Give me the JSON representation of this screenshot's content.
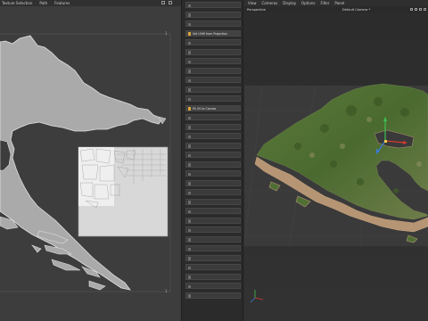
{
  "uv_editor": {
    "menu": [
      "Texture Selection",
      "Path",
      "Features"
    ],
    "tick_top_right": "1",
    "tick_bottom_right": "1"
  },
  "commands": [
    {
      "label": "",
      "state": "dim",
      "icon": "command-icon"
    },
    {
      "label": "",
      "state": "dim",
      "icon": "command-icon"
    },
    {
      "label": "",
      "state": "dim",
      "icon": "command-icon"
    },
    {
      "label": "Set UVW from Projection",
      "state": "bright",
      "icon": "projection-icon"
    },
    {
      "label": "",
      "state": "dim",
      "icon": "command-icon"
    },
    {
      "label": "",
      "state": "dim",
      "icon": "command-icon"
    },
    {
      "label": "",
      "state": "dim",
      "icon": "command-icon"
    },
    {
      "label": "",
      "state": "dim",
      "icon": "command-icon"
    },
    {
      "label": "",
      "state": "dim",
      "icon": "command-icon"
    },
    {
      "label": "",
      "state": "dim",
      "icon": "command-icon"
    },
    {
      "label": "",
      "state": "dim",
      "icon": "command-icon"
    },
    {
      "label": "Fit UV to Canvas",
      "state": "bright",
      "icon": "fit-canvas-icon"
    },
    {
      "label": "",
      "state": "dim",
      "icon": "command-icon"
    },
    {
      "label": "",
      "state": "dim",
      "icon": "command-icon"
    },
    {
      "label": "",
      "state": "dim",
      "icon": "command-icon"
    },
    {
      "label": "",
      "state": "dim",
      "icon": "command-icon"
    },
    {
      "label": "",
      "state": "dim",
      "icon": "command-icon"
    },
    {
      "label": "",
      "state": "dim",
      "icon": "command-icon"
    },
    {
      "label": "",
      "state": "dim",
      "icon": "command-icon"
    },
    {
      "label": "",
      "state": "dim",
      "icon": "command-icon"
    },
    {
      "label": "",
      "state": "dim",
      "icon": "command-icon"
    },
    {
      "label": "",
      "state": "dim",
      "icon": "command-icon"
    },
    {
      "label": "",
      "state": "dim",
      "icon": "command-icon"
    },
    {
      "label": "",
      "state": "dim",
      "icon": "command-icon"
    },
    {
      "label": "",
      "state": "dim",
      "icon": "command-icon"
    },
    {
      "label": "",
      "state": "dim",
      "icon": "command-icon"
    },
    {
      "label": "",
      "state": "dim",
      "icon": "command-icon"
    },
    {
      "label": "",
      "state": "dim",
      "icon": "command-icon"
    },
    {
      "label": "",
      "state": "dim",
      "icon": "command-icon"
    },
    {
      "label": "",
      "state": "dim",
      "icon": "command-icon"
    },
    {
      "label": "",
      "state": "dim",
      "icon": "command-icon"
    },
    {
      "label": "",
      "state": "dim",
      "icon": "command-icon"
    }
  ],
  "viewport": {
    "menu": [
      "View",
      "Cameras",
      "Display",
      "Options",
      "Filter",
      "Panel"
    ],
    "view_name": "Perspective",
    "camera_name": "Default Camera *"
  },
  "colors": {
    "accent": "#d9a53a",
    "terrain_green": "#4f6e33",
    "terrain_edge": "#b59574",
    "axis_x": "#d63b2f",
    "axis_y": "#3fc150",
    "axis_z": "#3a7ad8"
  }
}
